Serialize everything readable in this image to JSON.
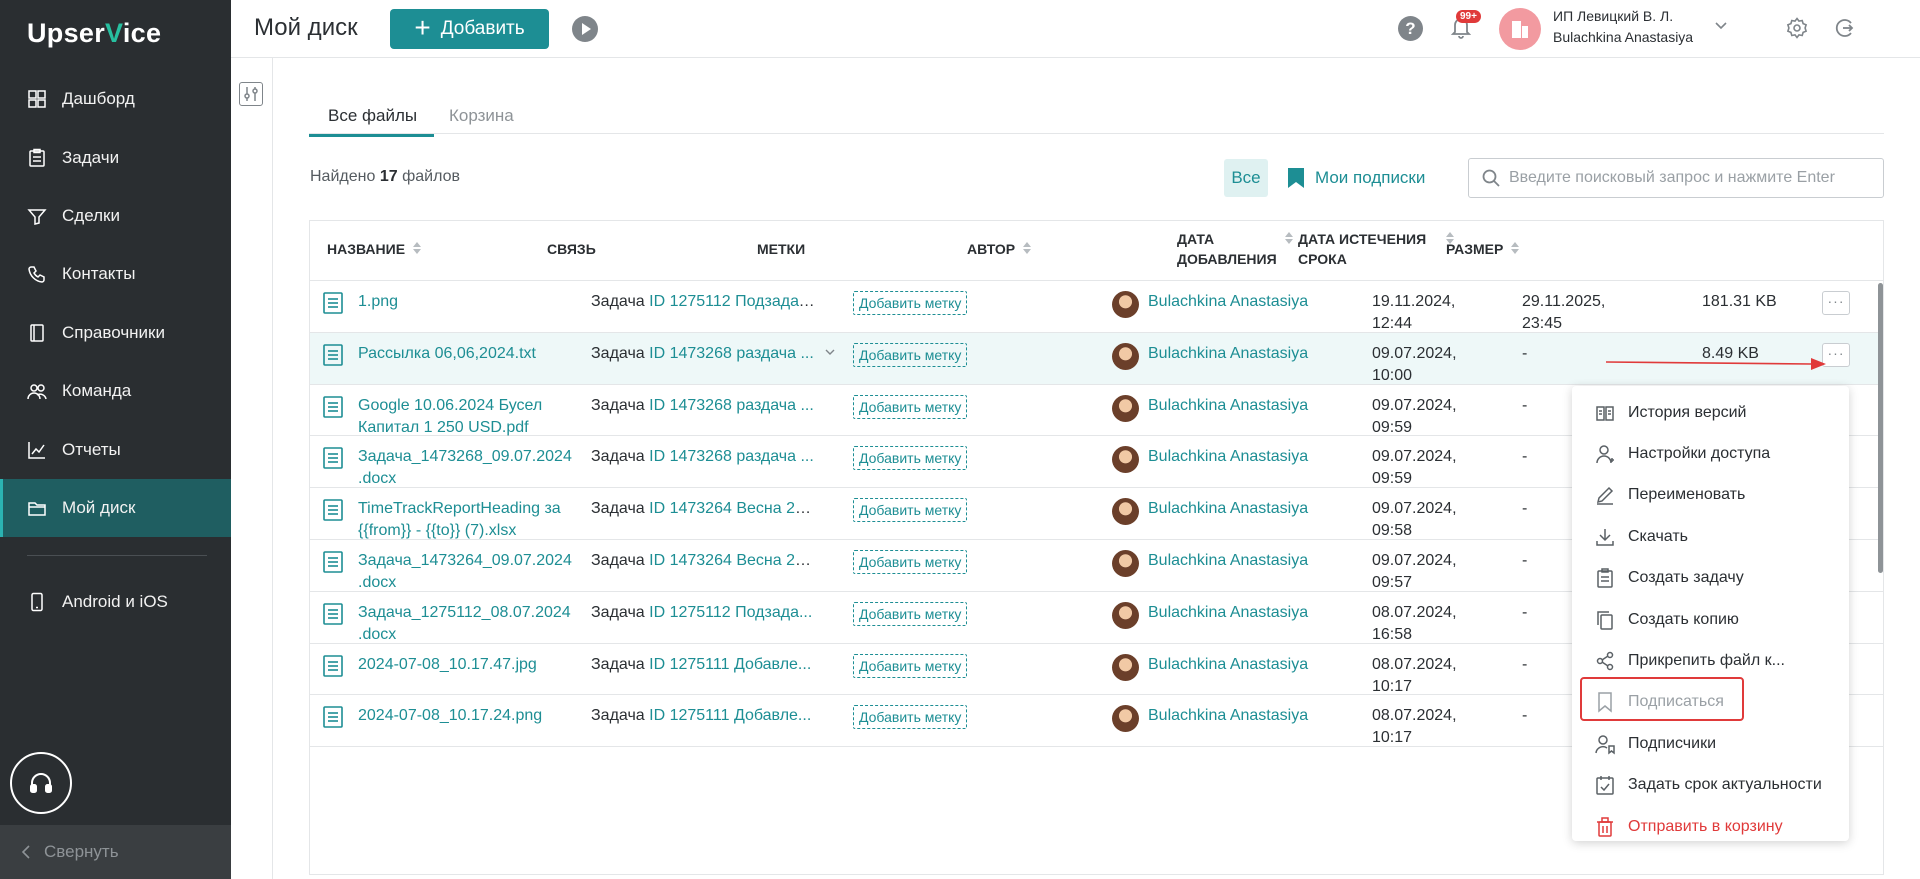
{
  "sidebar": {
    "logo_part1": "Upser",
    "logo_v": "V",
    "logo_part2": "ice",
    "items": [
      {
        "label": "Дашборд",
        "icon": "dashboard-icon"
      },
      {
        "label": "Задачи",
        "icon": "tasks-icon"
      },
      {
        "label": "Сделки",
        "icon": "deals-icon"
      },
      {
        "label": "Контакты",
        "icon": "contacts-icon"
      },
      {
        "label": "Справочники",
        "icon": "directory-icon"
      },
      {
        "label": "Команда",
        "icon": "team-icon"
      },
      {
        "label": "Отчеты",
        "icon": "reports-icon"
      },
      {
        "label": "Мой диск",
        "icon": "folder-icon",
        "active": true
      }
    ],
    "mobile_label": "Android и iOS",
    "collapse_label": "Свернуть"
  },
  "header": {
    "title": "Мой диск",
    "add_label": "Добавить",
    "notif_badge": "99+",
    "company": "ИП Левицкий В. Л.",
    "user": "Bulachkina Anastasiya"
  },
  "tabs": [
    {
      "label": "Все файлы",
      "active": true
    },
    {
      "label": "Корзина"
    }
  ],
  "toolbar": {
    "found_prefix": "Найдено",
    "found_count": "17",
    "found_suffix": "файлов",
    "all_label": "Все",
    "subs_label": "Мои подписки",
    "search_placeholder": "Введите поисковый запрос и нажмите Enter"
  },
  "columns": {
    "name": "НАЗВАНИЕ",
    "link": "СВЯЗЬ",
    "tags": "МЕТКИ",
    "author": "АВТОР",
    "added_1": "ДАТА",
    "added_2": "ДОБАВЛЕНИЯ",
    "expire_1": "ДАТА ИСТЕЧЕНИЯ",
    "expire_2": "СРОКА",
    "size": "РАЗМЕР"
  },
  "tag_label": "Добавить метку",
  "rows": [
    {
      "name": "1.png",
      "link_type": "Задача",
      "link_id": "ID 1275112 Подзадача...",
      "author": "Bulachkina Anastasiya",
      "added": "19.11.2024, 12:44",
      "expire": "29.11.2025, 23:45",
      "size": "181.31 KB"
    },
    {
      "name": "Рассылка 06,06,2024.txt",
      "link_type": "Задача",
      "link_id": "ID 1473268 раздача ...",
      "author": "Bulachkina Anastasiya",
      "added": "09.07.2024, 10:00",
      "expire": "-",
      "size": "8.49 KB"
    },
    {
      "name": "Google 10.06.2024 Бусел Капитал 1 250 USD.pdf",
      "link_type": "Задача",
      "link_id": "ID 1473268 раздача ...",
      "author": "Bulachkina Anastasiya",
      "added": "09.07.2024, 09:59",
      "expire": "-",
      "size": ""
    },
    {
      "name": "Задача_1473268_09.07.2024 .docx",
      "link_type": "Задача",
      "link_id": "ID 1473268 раздача ...",
      "author": "Bulachkina Anastasiya",
      "added": "09.07.2024, 09:59",
      "expire": "-",
      "size": ""
    },
    {
      "name": "TimeTrackReportHeading за {{from}} - {{to}} (7).xlsx",
      "link_type": "Задача",
      "link_id": "ID 1473264 Весна 20...",
      "author": "Bulachkina Anastasiya",
      "added": "09.07.2024, 09:58",
      "expire": "-",
      "size": ""
    },
    {
      "name": "Задача_1473264_09.07.2024 .docx",
      "link_type": "Задача",
      "link_id": "ID 1473264 Весна 20...",
      "author": "Bulachkina Anastasiya",
      "added": "09.07.2024, 09:57",
      "expire": "-",
      "size": ""
    },
    {
      "name": "Задача_1275112_08.07.2024 .docx",
      "link_type": "Задача",
      "link_id": "ID 1275112 Подзада...",
      "author": "Bulachkina Anastasiya",
      "added": "08.07.2024, 16:58",
      "expire": "-",
      "size": ""
    },
    {
      "name": "2024-07-08_10.17.47.jpg",
      "link_type": "Задача",
      "link_id": "ID 1275111 Добавле...",
      "author": "Bulachkina Anastasiya",
      "added": "08.07.2024, 10:17",
      "expire": "-",
      "size": ""
    },
    {
      "name": "2024-07-08_10.17.24.png",
      "link_type": "Задача",
      "link_id": "ID 1275111 Добавле...",
      "author": "Bulachkina Anastasiya",
      "added": "08.07.2024, 10:17",
      "expire": "-",
      "size": ""
    }
  ],
  "menu": [
    {
      "label": "История версий",
      "icon": "history-icon"
    },
    {
      "label": "Настройки доступа",
      "icon": "access-icon"
    },
    {
      "label": "Переименовать",
      "icon": "rename-icon"
    },
    {
      "label": "Скачать",
      "icon": "download-icon"
    },
    {
      "label": "Создать задачу",
      "icon": "create-task-icon"
    },
    {
      "label": "Создать копию",
      "icon": "copy-icon"
    },
    {
      "label": "Прикрепить файл к...",
      "icon": "share-icon"
    },
    {
      "label": "Подписаться",
      "icon": "bookmark-icon",
      "muted": true
    },
    {
      "label": "Подписчики",
      "icon": "subscribers-icon"
    },
    {
      "label": "Задать срок актуальности",
      "icon": "calendar-check-icon"
    },
    {
      "label": "Отправить в корзину",
      "icon": "trash-icon",
      "danger": true
    }
  ],
  "colors": {
    "accent": "#1d8e94",
    "sidebar_bg": "#2a2e31",
    "sidebar_active": "#1f5e61",
    "danger": "#e03a3a"
  }
}
